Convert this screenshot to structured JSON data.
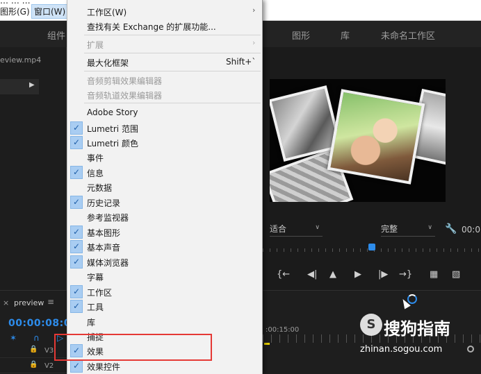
{
  "menubar": {
    "cut_text": "… … …",
    "graphics_menu": "图形(G)",
    "window_menu": "窗口(W)"
  },
  "workspace_tabs": {
    "components": "组件",
    "graphics": "图形",
    "library": "库",
    "untitled": "未命名工作区"
  },
  "left_panel": {
    "file_name": "eview.mp4"
  },
  "monitor": {
    "fit_label": "适合",
    "full_label": "完整",
    "timecode": "00:0"
  },
  "timeline": {
    "close": "×",
    "sequence_name": "preview",
    "menu_icon": "≡",
    "timecode": "00:00:08:08",
    "ruler_time": ":00:15:00",
    "tracks": [
      {
        "name": "V3"
      },
      {
        "name": "V2"
      }
    ]
  },
  "watermark": {
    "logo": "S",
    "title": "搜狗指南",
    "url": "zhinan.sogou.com"
  },
  "menu": {
    "items": [
      {
        "label": "工作区(W)",
        "submenu": true,
        "enabled": true,
        "checked": false,
        "shortcut": ""
      },
      {
        "label": "查找有关 Exchange 的扩展功能...",
        "submenu": false,
        "enabled": true,
        "checked": false,
        "shortcut": ""
      },
      {
        "label": "扩展",
        "submenu": true,
        "enabled": false,
        "checked": false,
        "shortcut": ""
      },
      {
        "label": "最大化框架",
        "submenu": false,
        "enabled": true,
        "checked": false,
        "shortcut": "Shift+`"
      },
      {
        "label": "音频剪辑效果编辑器",
        "submenu": false,
        "enabled": false,
        "checked": false,
        "shortcut": ""
      },
      {
        "label": "音频轨道效果编辑器",
        "submenu": false,
        "enabled": false,
        "checked": false,
        "shortcut": ""
      },
      {
        "label": "Adobe Story",
        "submenu": false,
        "enabled": true,
        "checked": false,
        "shortcut": ""
      },
      {
        "label": "Lumetri 范围",
        "submenu": false,
        "enabled": true,
        "checked": true,
        "shortcut": ""
      },
      {
        "label": "Lumetri 颜色",
        "submenu": false,
        "enabled": true,
        "checked": true,
        "shortcut": ""
      },
      {
        "label": "事件",
        "submenu": false,
        "enabled": true,
        "checked": false,
        "shortcut": ""
      },
      {
        "label": "信息",
        "submenu": false,
        "enabled": true,
        "checked": true,
        "shortcut": ""
      },
      {
        "label": "元数据",
        "submenu": false,
        "enabled": true,
        "checked": false,
        "shortcut": ""
      },
      {
        "label": "历史记录",
        "submenu": false,
        "enabled": true,
        "checked": true,
        "shortcut": ""
      },
      {
        "label": "参考监视器",
        "submenu": false,
        "enabled": true,
        "checked": false,
        "shortcut": ""
      },
      {
        "label": "基本图形",
        "submenu": false,
        "enabled": true,
        "checked": true,
        "shortcut": ""
      },
      {
        "label": "基本声音",
        "submenu": false,
        "enabled": true,
        "checked": true,
        "shortcut": ""
      },
      {
        "label": "媒体浏览器",
        "submenu": false,
        "enabled": true,
        "checked": true,
        "shortcut": ""
      },
      {
        "label": "字幕",
        "submenu": false,
        "enabled": true,
        "checked": false,
        "shortcut": ""
      },
      {
        "label": "工作区",
        "submenu": false,
        "enabled": true,
        "checked": true,
        "shortcut": ""
      },
      {
        "label": "工具",
        "submenu": false,
        "enabled": true,
        "checked": true,
        "shortcut": ""
      },
      {
        "label": "库",
        "submenu": false,
        "enabled": true,
        "checked": false,
        "shortcut": ""
      },
      {
        "label": "捕捉",
        "submenu": false,
        "enabled": true,
        "checked": false,
        "shortcut": ""
      },
      {
        "label": "效果",
        "submenu": false,
        "enabled": true,
        "checked": true,
        "shortcut": ""
      },
      {
        "label": "效果控件",
        "submenu": false,
        "enabled": true,
        "checked": true,
        "shortcut": ""
      }
    ]
  },
  "colors": {
    "accent_blue": "#2d8ceb",
    "highlight_red": "#e53935",
    "check_bg": "#a9cdf2"
  }
}
